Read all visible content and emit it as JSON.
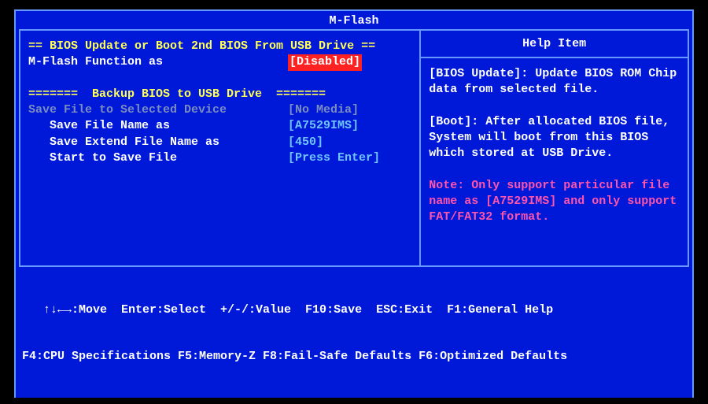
{
  "title": "M-Flash",
  "left": {
    "section1_header": "== BIOS Update or Boot 2nd BIOS From USB Drive ==",
    "mflash_function_label": "M-Flash Function as",
    "mflash_function_value": "[Disabled]",
    "section2_header": "=======  Backup BIOS to USB Drive  =======",
    "save_device_label": "Save File to Selected Device",
    "save_device_value": "[No Media]",
    "save_name_label": "   Save File Name as",
    "save_name_value": "[A7529IMS]",
    "save_ext_label": "   Save Extend File Name as",
    "save_ext_value": "[450]",
    "start_save_label": "   Start to Save File",
    "start_save_value": "[Press Enter]"
  },
  "help": {
    "title": "Help Item",
    "p1": "[BIOS Update]: Update BIOS ROM Chip data from selected file.",
    "p2": "[Boot]: After allocated BIOS file, System will boot from this BIOS which stored at USB Drive.",
    "note": "Note: Only support particular file name as [A7529IMS] and only support FAT/FAT32 format."
  },
  "footer": {
    "line1": "   ↑↓←→:Move  Enter:Select  +/-/:Value  F10:Save  ESC:Exit  F1:General Help",
    "line2": "F4:CPU Specifications F5:Memory-Z F8:Fail-Safe Defaults F6:Optimized Defaults"
  }
}
